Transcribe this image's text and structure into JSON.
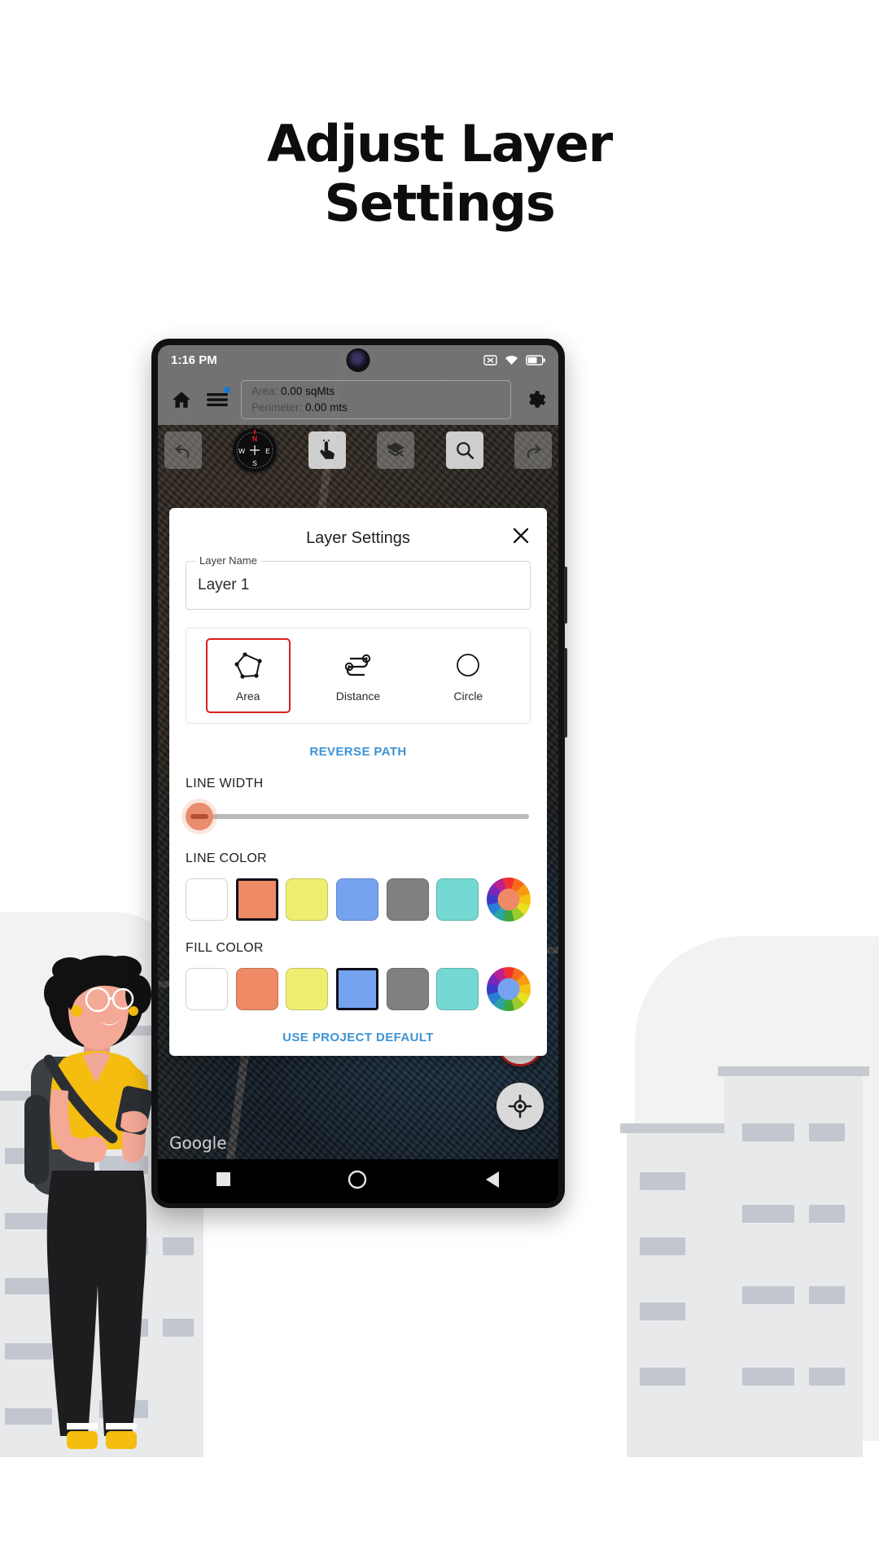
{
  "headline": {
    "line1": "Adjust Layer",
    "line2": "Settings"
  },
  "phone": {
    "statusbar": {
      "time": "1:16 PM",
      "icons": [
        "no-sim-icon",
        "wifi-icon",
        "battery-icon"
      ]
    },
    "appbar": {
      "home_icon": "home-icon",
      "menu_icon": "hamburger-menu-icon",
      "menu_badge": true,
      "settings_icon": "gear-icon",
      "area_label": "Area:",
      "area_value": "0.00 sqMts",
      "perimeter_label": "Perimeter:",
      "perimeter_value": "0.00 mts"
    },
    "toolbar": {
      "undo": "undo-icon",
      "compass": {
        "n": "N",
        "e": "E",
        "s": "S",
        "w": "W"
      },
      "tap": "tap-pointer-icon",
      "layers": "layers-icon",
      "search": "search-icon",
      "redo": "redo-icon"
    },
    "map_attribution": "Google",
    "fab": {
      "pencil": "pencil-icon",
      "locate": "my-location-icon"
    },
    "navbar": {
      "recent": "square-recents-icon",
      "home": "circle-home-icon",
      "back": "triangle-back-icon"
    }
  },
  "dialog": {
    "title": "Layer Settings",
    "close_icon": "close-icon",
    "layer_name": {
      "label": "Layer Name",
      "value": "Layer 1"
    },
    "shape_options": [
      {
        "label": "Area",
        "icon": "polygon-icon",
        "selected": true
      },
      {
        "label": "Distance",
        "icon": "path-distance-icon",
        "selected": false
      },
      {
        "label": "Circle",
        "icon": "circle-icon",
        "selected": false
      }
    ],
    "reverse_path_label": "REVERSE PATH",
    "line_width": {
      "label": "LINE WIDTH",
      "value": 0,
      "min": 0,
      "max": 100
    },
    "line_color": {
      "label": "LINE COLOR",
      "swatches": [
        "#ffffff",
        "#ee8a66",
        "#f0ee72",
        "#76a3ef",
        "#808080",
        "#74d9d2"
      ],
      "selected_index": 1,
      "wheel_center": "#ee8a66"
    },
    "fill_color": {
      "label": "FILL COLOR",
      "swatches": [
        "#ffffff",
        "#ee8a66",
        "#f0ee72",
        "#76a3ef",
        "#808080",
        "#74d9d2"
      ],
      "selected_index": 3,
      "wheel_center": "#76a3ef"
    },
    "use_project_default_label": "USE PROJECT DEFAULT"
  },
  "colors": {
    "accent_link": "#3d93d6",
    "selection_red": "#d81f20",
    "badge_blue": "#1778d0",
    "slider_thumb": "#ea8d6e"
  }
}
